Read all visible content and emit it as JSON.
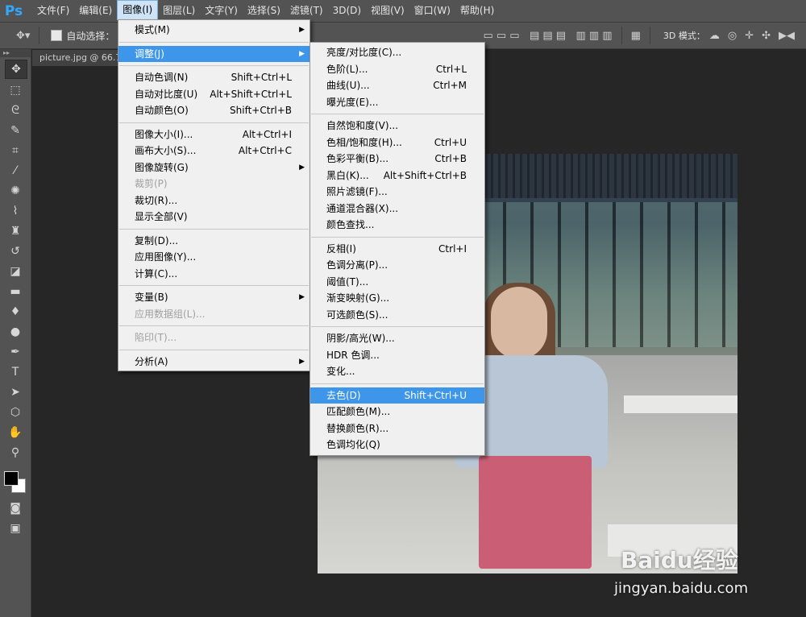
{
  "app": {
    "logo": "Ps"
  },
  "menubar": {
    "items": [
      "文件(F)",
      "编辑(E)",
      "图像(I)",
      "图层(L)",
      "文字(Y)",
      "选择(S)",
      "滤镜(T)",
      "3D(D)",
      "视图(V)",
      "窗口(W)",
      "帮助(H)"
    ],
    "active_index": 2
  },
  "optionsbar": {
    "auto_select_label": "自动选择：",
    "mode_label": "3D 模式："
  },
  "document": {
    "tab_title": "picture.jpg @ 66.7"
  },
  "image_menu": {
    "items": [
      {
        "label": "模式(M)",
        "shortcut": "",
        "submenu": true
      },
      {
        "sep": true
      },
      {
        "label": "调整(J)",
        "shortcut": "",
        "submenu": true,
        "highlight": true
      },
      {
        "sep": true
      },
      {
        "label": "自动色调(N)",
        "shortcut": "Shift+Ctrl+L"
      },
      {
        "label": "自动对比度(U)",
        "shortcut": "Alt+Shift+Ctrl+L"
      },
      {
        "label": "自动颜色(O)",
        "shortcut": "Shift+Ctrl+B"
      },
      {
        "sep": true
      },
      {
        "label": "图像大小(I)...",
        "shortcut": "Alt+Ctrl+I"
      },
      {
        "label": "画布大小(S)...",
        "shortcut": "Alt+Ctrl+C"
      },
      {
        "label": "图像旋转(G)",
        "shortcut": "",
        "submenu": true
      },
      {
        "label": "裁剪(P)",
        "shortcut": "",
        "disabled": true
      },
      {
        "label": "裁切(R)...",
        "shortcut": ""
      },
      {
        "label": "显示全部(V)",
        "shortcut": ""
      },
      {
        "sep": true
      },
      {
        "label": "复制(D)...",
        "shortcut": ""
      },
      {
        "label": "应用图像(Y)...",
        "shortcut": ""
      },
      {
        "label": "计算(C)...",
        "shortcut": ""
      },
      {
        "sep": true
      },
      {
        "label": "变量(B)",
        "shortcut": "",
        "submenu": true
      },
      {
        "label": "应用数据组(L)...",
        "shortcut": "",
        "disabled": true
      },
      {
        "sep": true
      },
      {
        "label": "陷印(T)...",
        "shortcut": "",
        "disabled": true
      },
      {
        "sep": true
      },
      {
        "label": "分析(A)",
        "shortcut": "",
        "submenu": true
      }
    ]
  },
  "adjust_menu": {
    "items": [
      {
        "label": "亮度/对比度(C)...",
        "shortcut": ""
      },
      {
        "label": "色阶(L)...",
        "shortcut": "Ctrl+L"
      },
      {
        "label": "曲线(U)...",
        "shortcut": "Ctrl+M"
      },
      {
        "label": "曝光度(E)...",
        "shortcut": ""
      },
      {
        "sep": true
      },
      {
        "label": "自然饱和度(V)...",
        "shortcut": ""
      },
      {
        "label": "色相/饱和度(H)...",
        "shortcut": "Ctrl+U"
      },
      {
        "label": "色彩平衡(B)...",
        "shortcut": "Ctrl+B"
      },
      {
        "label": "黑白(K)...",
        "shortcut": "Alt+Shift+Ctrl+B"
      },
      {
        "label": "照片滤镜(F)...",
        "shortcut": ""
      },
      {
        "label": "通道混合器(X)...",
        "shortcut": ""
      },
      {
        "label": "颜色查找...",
        "shortcut": ""
      },
      {
        "sep": true
      },
      {
        "label": "反相(I)",
        "shortcut": "Ctrl+I"
      },
      {
        "label": "色调分离(P)...",
        "shortcut": ""
      },
      {
        "label": "阈值(T)...",
        "shortcut": ""
      },
      {
        "label": "渐变映射(G)...",
        "shortcut": ""
      },
      {
        "label": "可选颜色(S)...",
        "shortcut": ""
      },
      {
        "sep": true
      },
      {
        "label": "阴影/高光(W)...",
        "shortcut": ""
      },
      {
        "label": "HDR 色调...",
        "shortcut": ""
      },
      {
        "label": "变化...",
        "shortcut": ""
      },
      {
        "sep": true
      },
      {
        "label": "去色(D)",
        "shortcut": "Shift+Ctrl+U",
        "highlight": true
      },
      {
        "label": "匹配颜色(M)...",
        "shortcut": ""
      },
      {
        "label": "替换颜色(R)...",
        "shortcut": ""
      },
      {
        "label": "色调均化(Q)",
        "shortcut": ""
      }
    ]
  },
  "colors": {
    "highlight": "#3d96e9",
    "menu_bg": "#f0f0f0",
    "app_bg": "#535353"
  },
  "watermark": {
    "logo_text": "Baidu经验",
    "url": "jingyan.baidu.com"
  }
}
